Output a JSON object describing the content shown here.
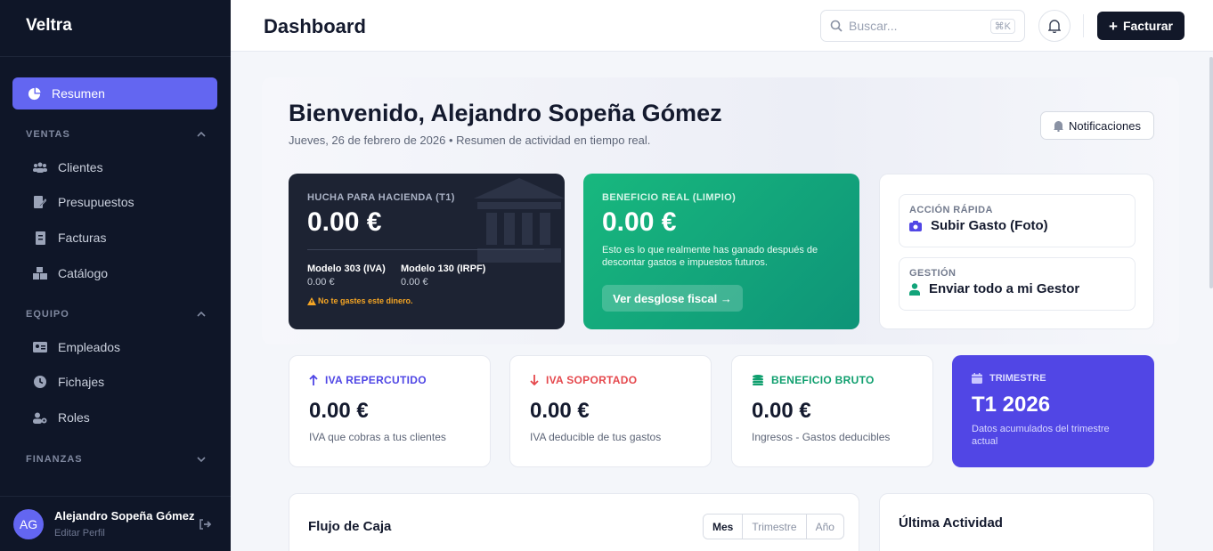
{
  "brand": "Veltra",
  "sidebar": {
    "active": "Resumen",
    "sections": [
      {
        "label": "VENTAS",
        "items": [
          "Clientes",
          "Presupuestos",
          "Facturas",
          "Catálogo"
        ]
      },
      {
        "label": "EQUIPO",
        "items": [
          "Empleados",
          "Fichajes",
          "Roles"
        ]
      },
      {
        "label": "FINANZAS",
        "items": []
      }
    ],
    "user": {
      "initials": "AG",
      "name": "Alejandro Sopeña Gómez",
      "sub": "Editar Perfil"
    }
  },
  "topbar": {
    "title": "Dashboard",
    "search_placeholder": "Buscar...",
    "search_shortcut": "⌘K",
    "bill_label": "Facturar"
  },
  "hero": {
    "welcome": "Bienvenido, Alejandro Sopeña Gómez",
    "subline": "Jueves, 26 de febrero de 2026 • Resumen de actividad en tiempo real.",
    "notif_label": "Notificaciones"
  },
  "hucha": {
    "caption": "HUCHA PARA HACIENDA (T1)",
    "value": "0.00 €",
    "m303_label": "Modelo 303 (IVA)",
    "m303_value": "0.00 €",
    "m130_label": "Modelo 130 (IRPF)",
    "m130_value": "0.00 €",
    "warning": "No te gastes este dinero."
  },
  "beneficio": {
    "caption": "BENEFICIO REAL (LIMPIO)",
    "value": "0.00 €",
    "desc": "Esto es lo que realmente has ganado después de descontar gastos e impuestos futuros.",
    "button": "Ver desglose fiscal →"
  },
  "quick": [
    {
      "caption": "ACCIÓN RÁPIDA",
      "title": "Subir Gasto (Foto)"
    },
    {
      "caption": "GESTIÓN",
      "title": "Enviar todo a mi Gestor"
    }
  ],
  "stats": [
    {
      "caption": "IVA REPERCUTIDO",
      "value": "0.00 €",
      "desc": "IVA que cobras a tus clientes",
      "color": "#4f46e5"
    },
    {
      "caption": "IVA SOPORTADO",
      "value": "0.00 €",
      "desc": "IVA deducible de tus gastos",
      "color": "#e5484d"
    },
    {
      "caption": "BENEFICIO BRUTO",
      "value": "0.00 €",
      "desc": "Ingresos - Gastos deducibles",
      "color": "#0f9f6e"
    }
  ],
  "trimestre": {
    "caption": "TRIMESTRE",
    "value": "T1 2026",
    "desc": "Datos acumulados del trimestre actual"
  },
  "flow": {
    "title": "Flujo de Caja",
    "tabs": [
      "Mes",
      "Trimestre",
      "Año"
    ]
  },
  "activity": {
    "title": "Última Actividad"
  },
  "colors": {
    "accent": "#6366f1",
    "sidebar": "#0f1628",
    "green": "#12a47a",
    "dark_card": "#1d2333"
  }
}
